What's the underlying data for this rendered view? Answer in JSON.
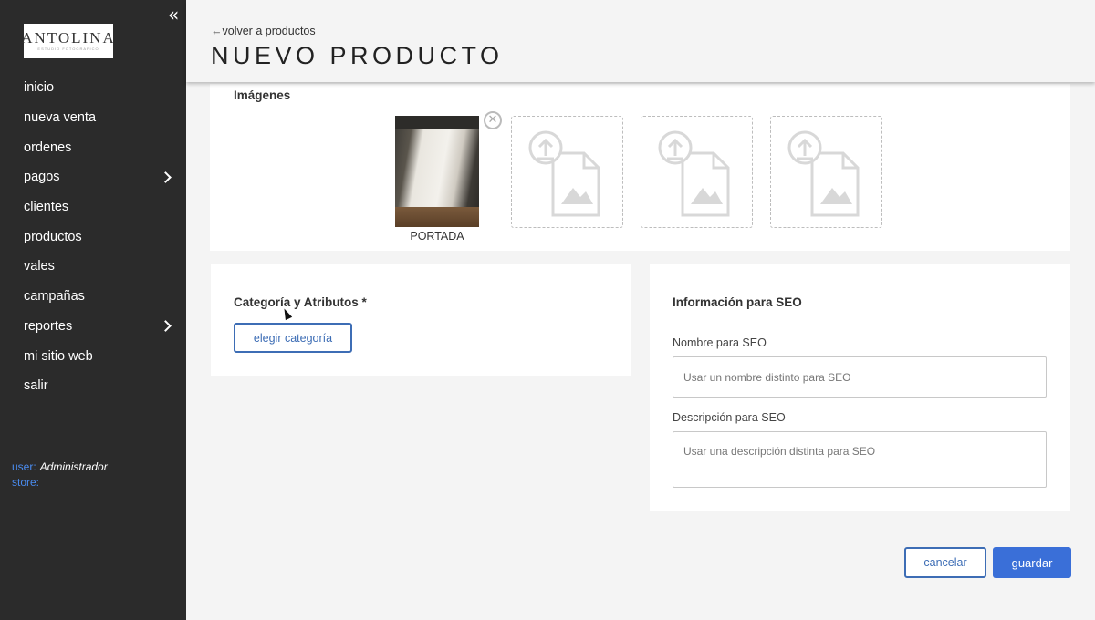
{
  "sidebar": {
    "collapse_icon": "«",
    "logo": {
      "name": "ANTOLINA",
      "tagline": "ESTUDIO FOTOGRAFICO"
    },
    "items": [
      {
        "label": "inicio",
        "has_submenu": false
      },
      {
        "label": "nueva venta",
        "has_submenu": false
      },
      {
        "label": "ordenes",
        "has_submenu": false
      },
      {
        "label": "pagos",
        "has_submenu": true
      },
      {
        "label": "clientes",
        "has_submenu": false
      },
      {
        "label": "productos",
        "has_submenu": false
      },
      {
        "label": "vales",
        "has_submenu": false
      },
      {
        "label": "campañas",
        "has_submenu": false
      },
      {
        "label": "reportes",
        "has_submenu": true
      },
      {
        "label": "mi sitio web",
        "has_submenu": false
      },
      {
        "label": "salir",
        "has_submenu": false
      }
    ],
    "user_label": "user:",
    "user_value": "Administrador",
    "store_label": "store:",
    "store_value": ""
  },
  "header": {
    "back_link": "←volver a productos",
    "title": "NUEVO PRODUCTO"
  },
  "images": {
    "title": "Imágenes",
    "cover_label": "PORTADA",
    "remove_icon": "✕",
    "empty_slot_icon": "image-upload-icon"
  },
  "category": {
    "title": "Categoría y Atributos *",
    "button_label": "elegir categoría"
  },
  "seo": {
    "title": "Información para SEO",
    "name_label": "Nombre para SEO",
    "name_placeholder": "Usar un nombre distinto para SEO",
    "name_value": "",
    "desc_label": "Descripción para SEO",
    "desc_placeholder": "Usar una descripción distinta para SEO",
    "desc_value": ""
  },
  "actions": {
    "cancel_label": "cancelar",
    "save_label": "guardar"
  },
  "colors": {
    "sidebar_bg": "#2b2b2b",
    "accent": "#3a6fd8",
    "outline_button": "#3d6db5",
    "user_label": "#4a8cf0"
  }
}
